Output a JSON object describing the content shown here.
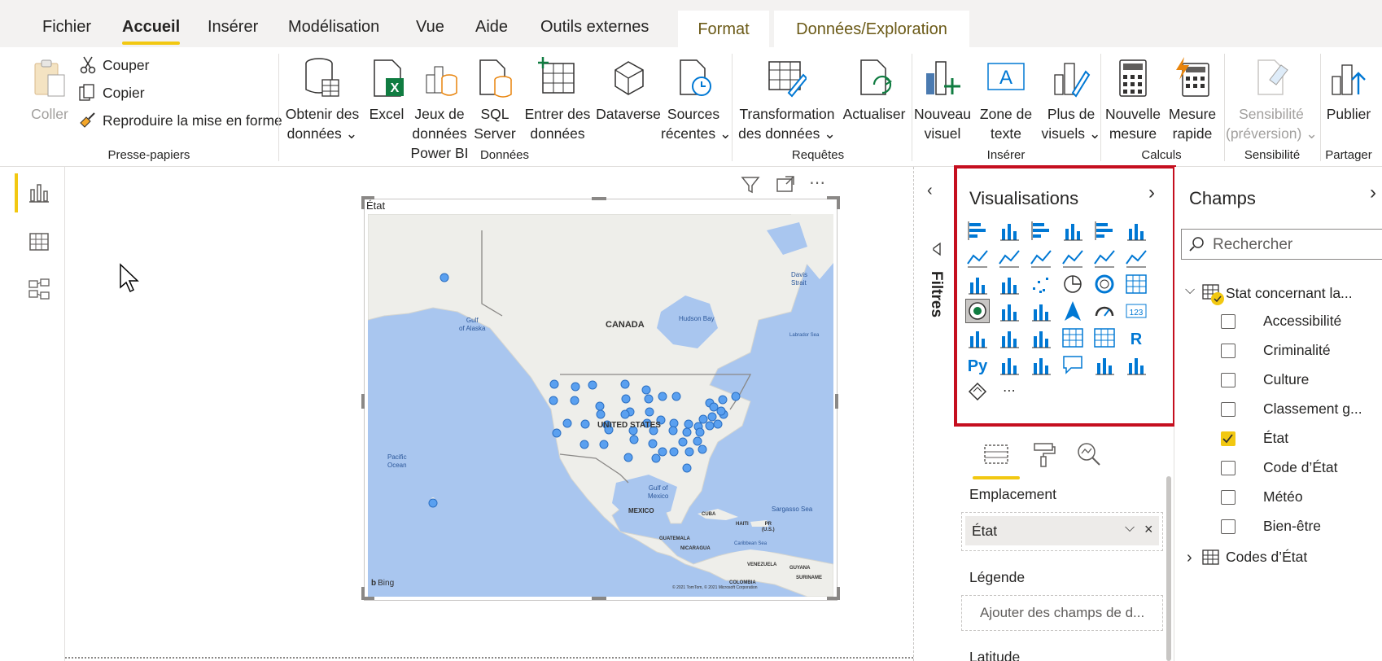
{
  "tabs": {
    "items": [
      "Fichier",
      "Accueil",
      "Insérer",
      "Modélisation",
      "Vue",
      "Aide",
      "Outils externes"
    ],
    "active": "Accueil",
    "contextual": [
      "Format",
      "Données/Exploration"
    ]
  },
  "ribbon": {
    "clipboard": {
      "paste": "Coller",
      "cut": "Couper",
      "copy": "Copier",
      "format_painter": "Reproduire la mise en forme",
      "group": "Presse-papiers"
    },
    "data": {
      "get_data": [
        "Obtenir des",
        "données"
      ],
      "excel": "Excel",
      "datasets": [
        "Jeux de",
        "données",
        "Power BI"
      ],
      "sql": [
        "SQL",
        "Server"
      ],
      "enter_data": [
        "Entrer des",
        "données"
      ],
      "dataverse": "Dataverse",
      "recent_sources": [
        "Sources",
        "récentes"
      ],
      "group": "Données"
    },
    "queries": {
      "transform": [
        "Transformation",
        "des données"
      ],
      "refresh": "Actualiser",
      "group": "Requêtes"
    },
    "insert": {
      "new_visual": [
        "Nouveau",
        "visuel"
      ],
      "text_box": [
        "Zone de",
        "texte"
      ],
      "more_visuals": [
        "Plus de",
        "visuels"
      ],
      "group": "Insérer"
    },
    "calculations": {
      "new_measure": [
        "Nouvelle",
        "mesure"
      ],
      "quick_measure": [
        "Mesure",
        "rapide"
      ],
      "group": "Calculs"
    },
    "sensitivity": {
      "label": [
        "Sensibilité",
        "(préversion)"
      ],
      "group": "Sensibilité"
    },
    "share": {
      "publish": "Publier",
      "group": "Partager"
    }
  },
  "visual": {
    "title": "État",
    "map_labels": {
      "canada": "CANADA",
      "us": "UNITED STATES",
      "mexico": "MEXICO",
      "gulf_alaska": [
        "Gulf",
        "of Alaska"
      ],
      "hudson": "Hudson Bay",
      "davis": [
        "Davis",
        "Strait"
      ],
      "labrador": "Labrador Sea",
      "pacific": [
        "Pacific",
        "Ocean"
      ],
      "gulf_mexico": [
        "Gulf of",
        "Mexico"
      ],
      "sargasso": "Sargasso Sea",
      "cuba": "CUBA",
      "haiti": "HAITI",
      "pr": [
        "PR",
        "(U.S.)"
      ],
      "guatemala": "GUATEMALA",
      "nicaragua": "NICARAGUA",
      "caribbean": "Caribbean Sea",
      "venezuela": "VENEZUELA",
      "guyana": "GUYANA",
      "suriname": "SURINAME",
      "colombia": "COLOMBIA"
    },
    "bing": "Bing",
    "copyright": "© 2021 TomTom, © 2021 Microsoft Corporation"
  },
  "filters": {
    "label": "Filtres"
  },
  "visualizations": {
    "title": "Visualisations",
    "wells": {
      "location": "Emplacement",
      "location_value": "État",
      "legend": "Légende",
      "legend_placeholder": "Ajouter des champs de d...",
      "latitude": "Latitude"
    },
    "icons": [
      "stacked-bar-icon",
      "stacked-column-icon",
      "clustered-bar-icon",
      "clustered-column-icon",
      "100-bar-icon",
      "100-column-icon",
      "line-chart-icon",
      "area-chart-icon",
      "stacked-area-icon",
      "line-column-icon",
      "line-clustered-column-icon",
      "ribbon-chart-icon",
      "waterfall-icon",
      "funnel-icon",
      "scatter-icon",
      "pie-icon",
      "donut-icon",
      "treemap-icon",
      "map-icon",
      "filled-map-icon",
      "shape-map-icon",
      "azure-map-icon",
      "gauge-icon",
      "card-icon",
      "multirow-card-icon",
      "kpi-icon",
      "slicer-icon",
      "table-icon",
      "matrix-icon",
      "r-visual-icon",
      "python-visual-icon",
      "key-influencers-icon",
      "decomposition-tree-icon",
      "qa-icon",
      "paginated-report-icon",
      "power-apps-icon",
      "power-automate-icon",
      "more-visuals-icon"
    ]
  },
  "fields": {
    "title": "Champs",
    "search_placeholder": "Rechercher",
    "tables": [
      {
        "name": "Stat concernant la...",
        "expanded": true,
        "fields": [
          {
            "name": "Accessibilité",
            "checked": false
          },
          {
            "name": "Criminalité",
            "checked": false
          },
          {
            "name": "Culture",
            "checked": false
          },
          {
            "name": "Classement g...",
            "checked": false
          },
          {
            "name": "État",
            "checked": true
          },
          {
            "name": "Code d’État",
            "checked": false
          },
          {
            "name": "Météo",
            "checked": false
          },
          {
            "name": "Bien-être",
            "checked": false
          }
        ]
      },
      {
        "name": "Codes d’État",
        "expanded": false
      }
    ]
  },
  "colors": {
    "accent_yellow": "#f2c811",
    "highlight_red": "#c50f1f",
    "map_water": "#a9c6ef",
    "map_land": "#eeeeea",
    "map_dot": "#5aa0f0",
    "contextual_tab_text": "#6b5a17"
  }
}
